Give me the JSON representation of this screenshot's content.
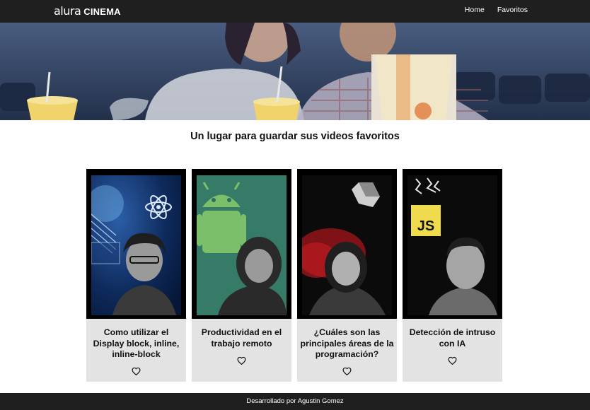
{
  "header": {
    "brand": "alura",
    "brand_suffix": "CINEMA",
    "nav": [
      {
        "label": "Home"
      },
      {
        "label": "Favoritos"
      }
    ]
  },
  "main": {
    "title": "Un lugar para guardar sus videos favoritos",
    "cards": [
      {
        "title": "Como utilizar el Display block, inline, inline-block",
        "favorite": false
      },
      {
        "title": "Productividad en el trabajo remoto",
        "favorite": false
      },
      {
        "title": "¿Cuáles son las principales áreas de la programación?",
        "favorite": false
      },
      {
        "title": "Detección de intruso con IA",
        "favorite": false
      }
    ],
    "card_badges": {
      "js": "JS"
    }
  },
  "footer": {
    "text": "Desarrollado por Agustin Gomez"
  },
  "colors": {
    "header_bg": "#1f1f1f",
    "card_bg": "#e3e3e3",
    "banner_tint": "#2b3a57",
    "js_yellow": "#f0db4f"
  }
}
